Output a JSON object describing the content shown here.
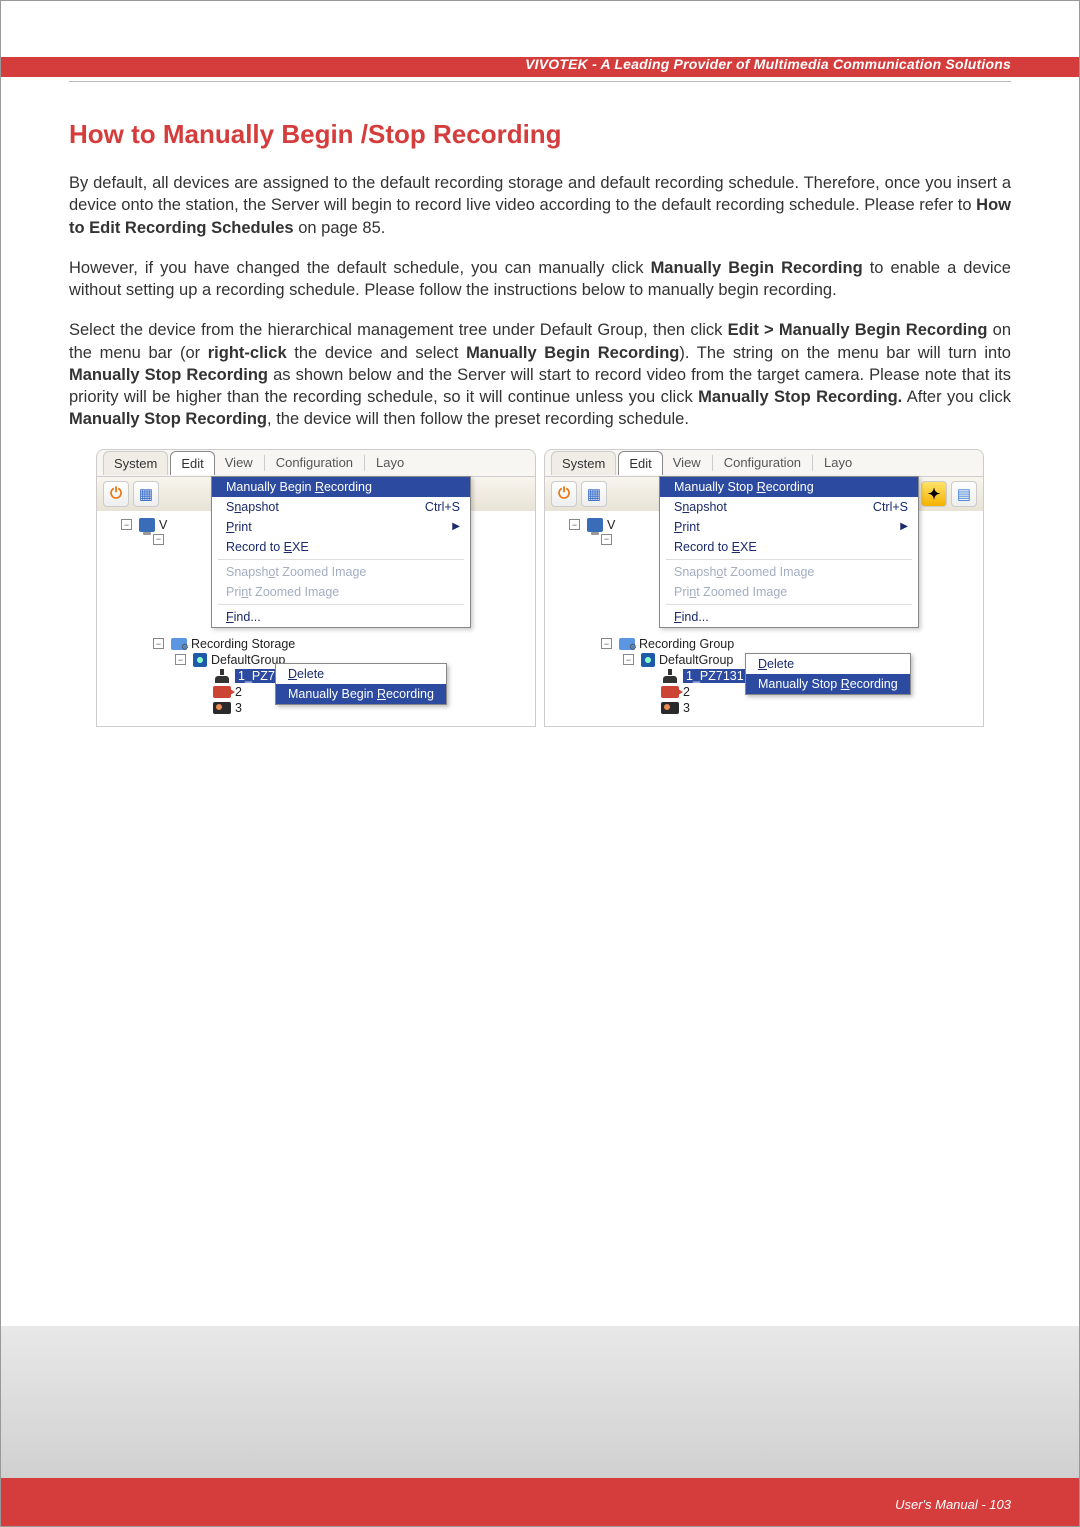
{
  "header": {
    "brand": "VIVOTEK - A Leading Provider of Multimedia Communication Solutions"
  },
  "title": "How to Manually Begin /Stop Recording",
  "para1_a": "By default, all devices are assigned to the default recording storage and default recording schedule. Therefore, once you insert a device onto the station, the Server will begin to record live video according to the default recording schedule. Please refer to ",
  "para1_b": "How to Edit Recording Schedules",
  "para1_c": " on page 85.",
  "para2_a": "However, if you have changed the default schedule, you can manually click ",
  "para2_b": "Manually Begin Recording",
  "para2_c": " to enable a device without setting up a recording schedule. Please follow the instructions below to manually begin recording.",
  "para3_a": "Select the device from the hierarchical management tree under Default Group, then click ",
  "para3_b": "Edit > Manually Begin Recording",
  "para3_c": " on the menu bar (or ",
  "para3_d": "right-click",
  "para3_e": " the device and select ",
  "para3_f": "Manually Begin Recording",
  "para3_g": "). The string on the menu bar will turn into ",
  "para3_h": "Manually Stop Recording",
  "para3_i": " as shown below and the Server will start to record video from the target camera. Please note that its priority will be higher than the recording schedule, so it will continue unless you click ",
  "para3_j": "Manually Stop Recording.",
  "para3_k": " After you click ",
  "para3_l": "Manually Stop Recording",
  "para3_m": ", the device will then follow the preset recording schedule.",
  "menubar": {
    "system": "System",
    "edit": "Edit",
    "view": "View",
    "configuration": "Configuration",
    "layout": "Layo"
  },
  "edit_menu": {
    "begin": "Manually Begin Recording",
    "stop": "Manually Stop Recording",
    "snapshot": "Snapshot",
    "snapshot_accel": "Ctrl+S",
    "print": "Print",
    "record_exe": "Record to EXE",
    "snap_zoom": "Snapshot Zoomed Image",
    "print_zoom": "Print Zoomed Image",
    "find": "Find..."
  },
  "tree": {
    "v": "V",
    "rec_storage": "Recording Storage",
    "rec_group": "Recording Group",
    "default_group": "DefaultGroup",
    "dev1": "1_PZ7131",
    "dev2": "2",
    "dev3": "3"
  },
  "ctx": {
    "delete": "Delete",
    "begin": "Manually Begin Recording",
    "stop": "Manually Stop Recording"
  },
  "footer": {
    "text": "User's Manual - 103"
  }
}
